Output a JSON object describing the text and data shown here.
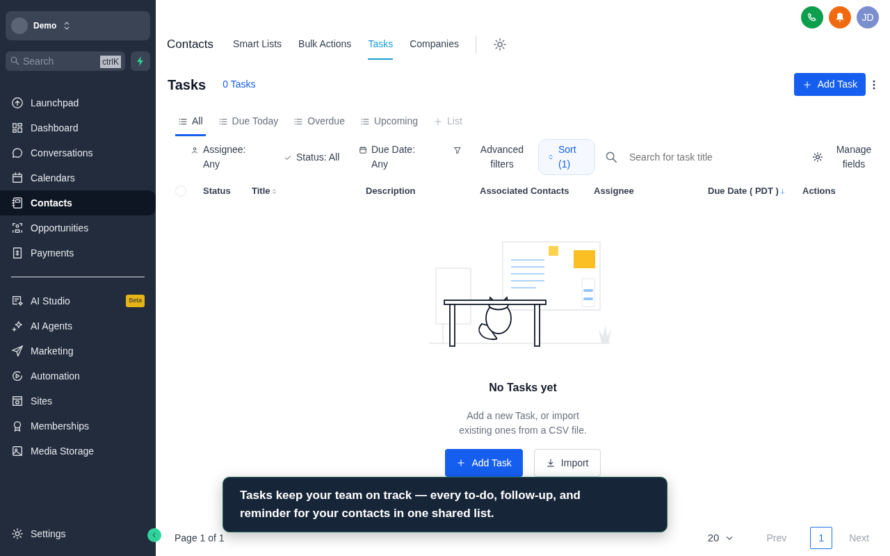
{
  "sidebar": {
    "account": {
      "name": "Demo"
    },
    "search": {
      "placeholder": "Search",
      "shortcut": "ctrlK"
    },
    "items": [
      {
        "label": "Launchpad",
        "selected": false
      },
      {
        "label": "Dashboard",
        "selected": false
      },
      {
        "label": "Conversations",
        "selected": false
      },
      {
        "label": "Calendars",
        "selected": false
      },
      {
        "label": "Contacts",
        "selected": true
      },
      {
        "label": "Opportunities",
        "selected": false
      },
      {
        "label": "Payments",
        "selected": false
      }
    ],
    "items2": [
      {
        "label": "AI Studio",
        "badge": "Beta",
        "selected": false
      },
      {
        "label": "AI Agents",
        "selected": false
      },
      {
        "label": "Marketing",
        "selected": false
      },
      {
        "label": "Automation",
        "selected": false
      },
      {
        "label": "Sites",
        "selected": false
      },
      {
        "label": "Memberships",
        "selected": false
      },
      {
        "label": "Media Storage",
        "selected": false
      }
    ],
    "settings": "Settings"
  },
  "header": {
    "avatar": "JD"
  },
  "nav": {
    "title": "Contacts",
    "tabs": [
      {
        "label": "Smart Lists",
        "selected": false
      },
      {
        "label": "Bulk Actions",
        "selected": false
      },
      {
        "label": "Tasks",
        "selected": true
      },
      {
        "label": "Companies",
        "selected": false
      }
    ]
  },
  "page": {
    "title": "Tasks",
    "count": "0 Tasks",
    "add_button": "Add Task"
  },
  "views": [
    {
      "label": "All",
      "kind": "view",
      "selected": true
    },
    {
      "label": "Due Today",
      "kind": "view",
      "selected": false
    },
    {
      "label": "Overdue",
      "kind": "view",
      "selected": false
    },
    {
      "label": "Upcoming",
      "kind": "view",
      "selected": false
    },
    {
      "label": "List",
      "kind": "add",
      "selected": false
    }
  ],
  "filters": [
    "Assignee: Any",
    "Status: All",
    "Due Date: Any",
    "Advanced filters"
  ],
  "sort": "Sort (1)",
  "search": {
    "placeholder": "Search for task title"
  },
  "manage": "Manage fields",
  "table": {
    "select_all": {
      "checked": false
    },
    "columns": [
      "Status",
      "Title",
      "Description",
      "Associated Contacts",
      "Assignee",
      "Due Date ( PDT )",
      "Actions"
    ]
  },
  "empty": {
    "title": "No Tasks yet",
    "text": "Add a new Task, or import existing ones from a CSV file.",
    "buttons": [
      "Add Task",
      "Import"
    ]
  },
  "tooltip": "Tasks keep your team on track — every to-do, follow-up, and reminder for your contacts in one shared list.",
  "pagination": {
    "label": "Page 1 of 1",
    "page_size": "20",
    "prev": "Prev",
    "pages": [
      {
        "label": "1",
        "selected": true
      }
    ],
    "next": "Next"
  }
}
